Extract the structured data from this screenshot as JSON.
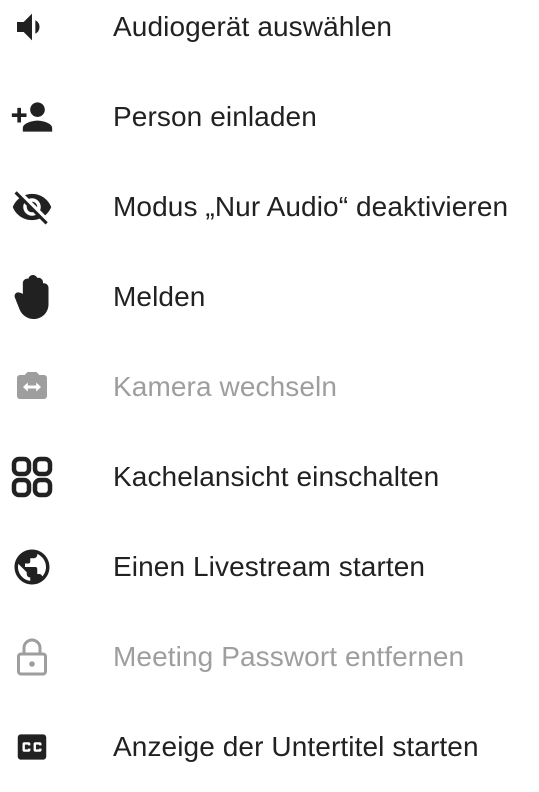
{
  "menu": {
    "items": [
      {
        "label": "Audiogerät auswählen",
        "icon": "volume-icon",
        "enabled": true
      },
      {
        "label": "Person einladen",
        "icon": "add-person-icon",
        "enabled": true
      },
      {
        "label": "Modus „Nur Audio“ deaktivieren",
        "icon": "visibility-off-icon",
        "enabled": true
      },
      {
        "label": "Melden",
        "icon": "raise-hand-icon",
        "enabled": true
      },
      {
        "label": "Kamera wechseln",
        "icon": "switch-camera-icon",
        "enabled": false
      },
      {
        "label": "Kachelansicht einschalten",
        "icon": "tile-view-icon",
        "enabled": true
      },
      {
        "label": "Einen Livestream starten",
        "icon": "globe-icon",
        "enabled": true
      },
      {
        "label": "Meeting Passwort entfernen",
        "icon": "lock-icon",
        "enabled": false
      },
      {
        "label": "Anzeige der Untertitel starten",
        "icon": "closed-captions-icon",
        "enabled": true
      }
    ]
  },
  "colors": {
    "enabled": "#212121",
    "disabled": "#9e9e9e"
  }
}
